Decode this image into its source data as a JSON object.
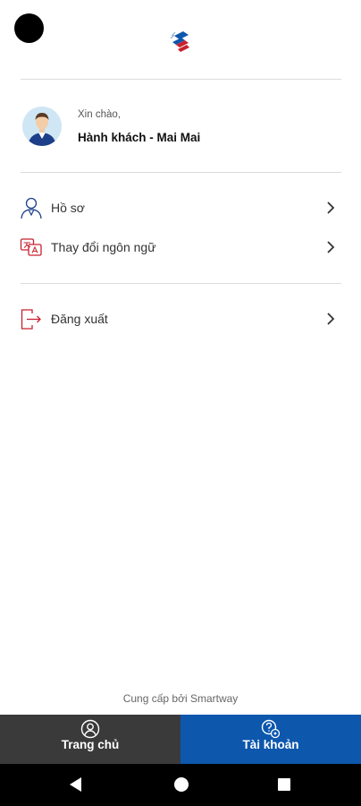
{
  "app": {
    "brand_colors": {
      "blue": "#0d57ad",
      "red": "#c8202f",
      "dark": "#3a3a3a"
    }
  },
  "greeting": {
    "hello": "Xin chào,",
    "name": "Hành khách - Mai Mai"
  },
  "menu": {
    "items": [
      {
        "label": "Hồ sơ",
        "icon": "person-icon"
      },
      {
        "label": "Thay đổi ngôn ngữ",
        "icon": "translate-icon"
      }
    ],
    "logout": {
      "label": "Đăng xuất",
      "icon": "logout-icon"
    }
  },
  "footer": {
    "provided_by": "Cung cấp bởi Smartway"
  },
  "tabs": {
    "home": "Trang chủ",
    "account": "Tài khoản",
    "active": "account"
  }
}
